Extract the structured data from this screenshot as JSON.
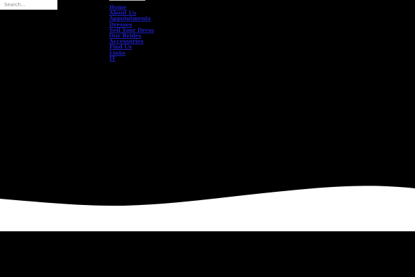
{
  "search": {
    "placeholder": "Search..."
  },
  "nav": {
    "items": [
      {
        "label": "Home"
      },
      {
        "label": "About Us"
      },
      {
        "label": "Appointments"
      },
      {
        "label": "Dresses"
      },
      {
        "label": "Sell Your Dress"
      },
      {
        "label": "Our Brides"
      },
      {
        "label": "Accessories"
      },
      {
        "label": "Find Us"
      },
      {
        "label": "Links"
      },
      {
        "label": "IT"
      }
    ]
  },
  "colors": {
    "background": "#000000",
    "link": "#1e1ec8",
    "wave": "#ffffff",
    "search_background": "#ffffff"
  }
}
